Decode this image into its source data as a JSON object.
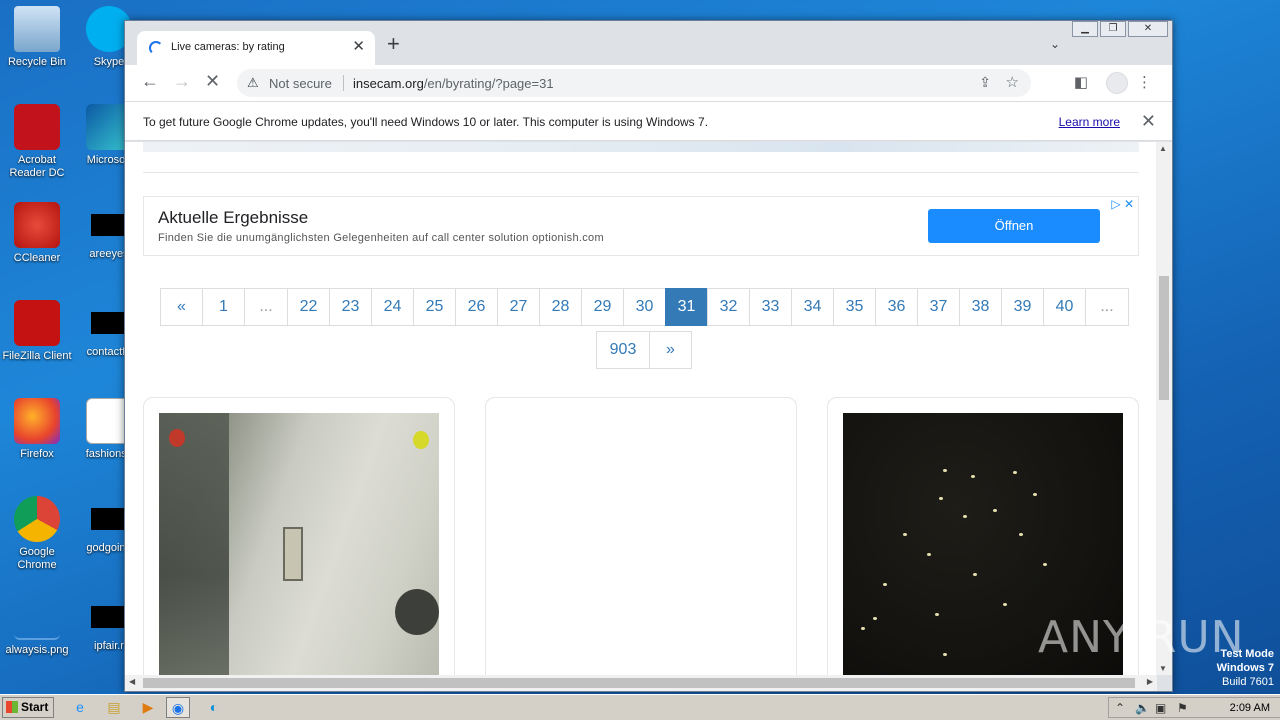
{
  "desktop": {
    "icons": [
      {
        "label": "Recycle Bin"
      },
      {
        "label": "Skype"
      },
      {
        "label": "Acrobat Reader DC"
      },
      {
        "label": "Microsoft"
      },
      {
        "label": "CCleaner"
      },
      {
        "label": "areeyes"
      },
      {
        "label": "FileZilla Client"
      },
      {
        "label": "contactfri"
      },
      {
        "label": "Firefox"
      },
      {
        "label": "fashionsy"
      },
      {
        "label": "Google Chrome"
      },
      {
        "label": "godgoing"
      },
      {
        "label": "alwaysis.png"
      },
      {
        "label": "ipfair.r"
      }
    ]
  },
  "browser": {
    "tab_title": "Live cameras: by rating",
    "new_tab_symbol": "+",
    "address": {
      "warning": "Not secure",
      "host": "insecam.org",
      "path": "/en/byrating/?page=31"
    },
    "infobar": {
      "message": "To get future Google Chrome updates, you'll need Windows 10 or later. This computer is using Windows 7.",
      "link": "Learn more"
    }
  },
  "page": {
    "ad": {
      "headline": "Aktuelle Ergebnisse",
      "subtext": "Finden Sie die unumgänglichsten Gelegenheiten auf call center solution optionish.com",
      "button": "Öffnen"
    },
    "pagination": {
      "row1": [
        "«",
        "1",
        "...",
        "22",
        "23",
        "24",
        "25",
        "26",
        "27",
        "28",
        "29",
        "30",
        "31",
        "32",
        "33",
        "34",
        "35",
        "36",
        "37",
        "38",
        "39",
        "40",
        "..."
      ],
      "row2": [
        "903",
        "»"
      ],
      "active": "31"
    }
  },
  "taskbar": {
    "start": "Start",
    "clock": "2:09 AM"
  },
  "overlay": {
    "watermark": "ANY RUN",
    "testmode_line1": "Test Mode",
    "testmode_line2": "Windows 7",
    "testmode_line3": "Build 7601"
  }
}
